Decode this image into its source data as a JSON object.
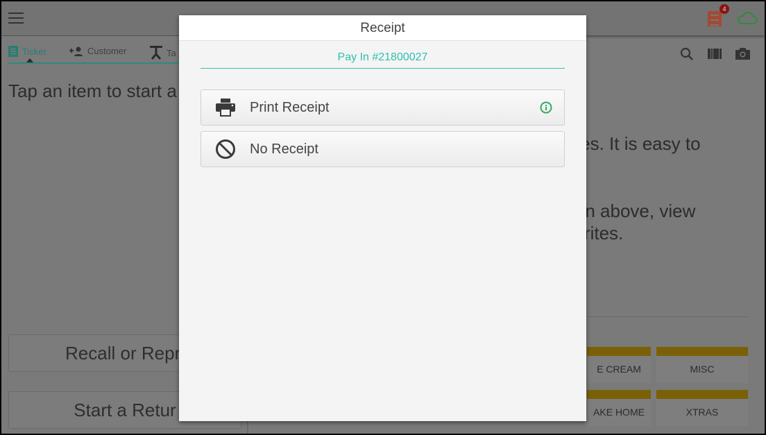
{
  "topbar": {
    "menu_icon": "hamburger-icon",
    "ticket_badge_count": "4",
    "ticket_icon_color": "#a24a33",
    "cloud_color": "#2e8b3e"
  },
  "left": {
    "tabs": [
      {
        "label": "Ticket",
        "icon": "ticket-icon"
      },
      {
        "label": "Customer",
        "icon": "add-person-icon"
      },
      {
        "label": "Ta",
        "icon": "table-icon"
      }
    ],
    "hint": "Tap an item to start a",
    "recall_label": "Recall or Repri",
    "return_label": "Start a Retur"
  },
  "right": {
    "tools": [
      "search-icon",
      "barcode-icon",
      "camera-icon"
    ],
    "text_lines": [
      "orites. It is easy to",
      "utton above, view",
      "avorites."
    ],
    "categories": [
      {
        "label": "E CREAM"
      },
      {
        "label": "MISC"
      },
      {
        "label": "AKE HOME"
      },
      {
        "label": "XTRAS"
      }
    ],
    "category_color": "#7a6108"
  },
  "modal": {
    "title": "Receipt",
    "subtitle": "Pay In #21800027",
    "accent": "#2ec4b0",
    "options": [
      {
        "label": "Print Receipt",
        "icon": "printer-icon"
      },
      {
        "label": "No Receipt",
        "icon": "block-icon"
      }
    ]
  }
}
